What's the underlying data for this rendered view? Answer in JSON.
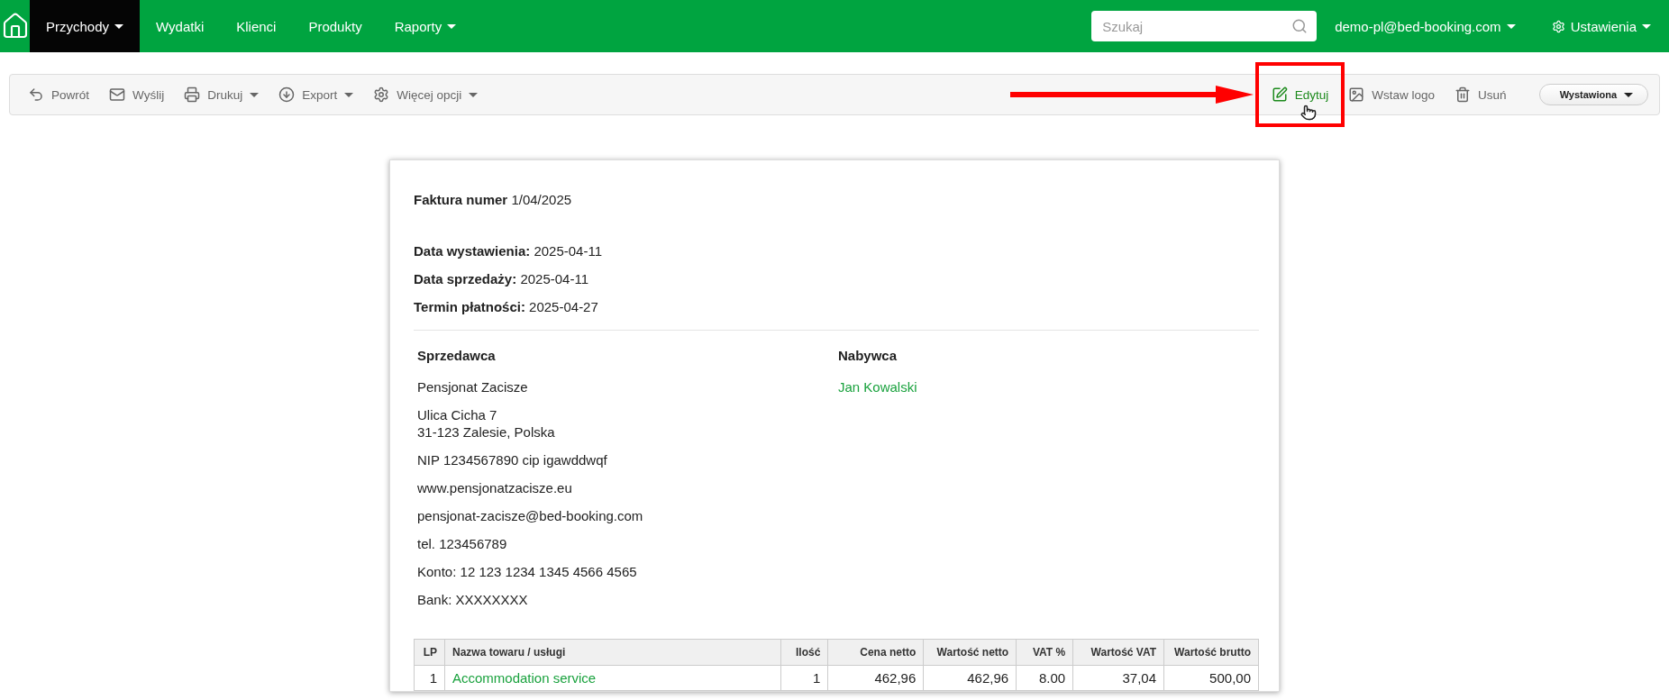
{
  "nav": {
    "items": [
      {
        "label": "Przychody",
        "dropdown": true,
        "selected": true
      },
      {
        "label": "Wydatki",
        "dropdown": false,
        "selected": false
      },
      {
        "label": "Klienci",
        "dropdown": false,
        "selected": false
      },
      {
        "label": "Produkty",
        "dropdown": false,
        "selected": false
      },
      {
        "label": "Raporty",
        "dropdown": true,
        "selected": false
      }
    ],
    "search": {
      "placeholder": "Szukaj"
    },
    "account": "demo-pl@bed-booking.com",
    "settings": "Ustawienia"
  },
  "toolbar": {
    "left": [
      {
        "kind": "back",
        "label": "Powrót",
        "dropdown": false
      },
      {
        "kind": "send",
        "label": "Wyślij",
        "dropdown": false
      },
      {
        "kind": "print",
        "label": "Drukuj",
        "dropdown": true
      },
      {
        "kind": "export",
        "label": "Export",
        "dropdown": true
      },
      {
        "kind": "more",
        "label": "Więcej opcji",
        "dropdown": true
      }
    ],
    "right": [
      {
        "kind": "edit",
        "label": "Edytuj",
        "highlighted": true
      },
      {
        "kind": "logo",
        "label": "Wstaw logo",
        "highlighted": false
      },
      {
        "kind": "delete",
        "label": "Usuń",
        "highlighted": false
      }
    ],
    "status": "Wystawiona"
  },
  "invoice": {
    "title_label": "Faktura numer",
    "number": "1/04/2025",
    "dates": [
      {
        "label": "Data wystawienia:",
        "value": "2025-04-11"
      },
      {
        "label": "Data sprzedaży:",
        "value": "2025-04-11"
      },
      {
        "label": "Termin płatności:",
        "value": "2025-04-27"
      }
    ],
    "seller": {
      "heading": "Sprzedawca",
      "entries": [
        [
          "Pensjonat Zacisze"
        ],
        [
          "Ulica Cicha 7",
          "31-123 Zalesie, Polska"
        ],
        [
          "NIP 1234567890 cip igawddwqf"
        ],
        [
          "www.pensjonatzacisze.eu"
        ],
        [
          "pensjonat-zacisze@bed-booking.com"
        ],
        [
          "tel. 123456789"
        ],
        [
          "Konto: 12 123 1234 1345 4566 4565"
        ],
        [
          "Bank: XXXXXXXX"
        ]
      ]
    },
    "buyer": {
      "heading": "Nabywca",
      "name": "Jan Kowalski"
    },
    "table": {
      "columns": [
        "LP",
        "Nazwa towaru / usługi",
        "Ilość",
        "Cena netto",
        "Wartość netto",
        "VAT %",
        "Wartość VAT",
        "Wartość brutto"
      ],
      "rows": [
        [
          "1",
          "Accommodation service",
          "1",
          "462,96",
          "462,96",
          "8.00",
          "37,04",
          "500,00"
        ]
      ]
    }
  }
}
